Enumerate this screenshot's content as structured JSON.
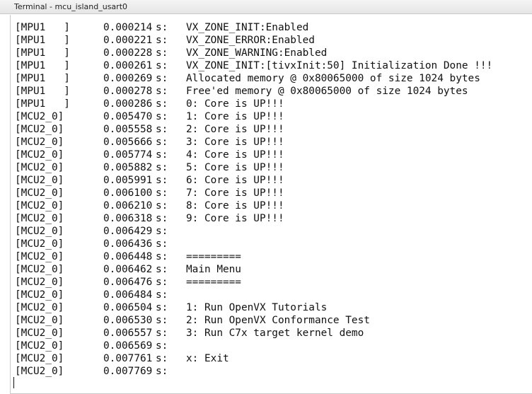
{
  "window": {
    "title": "Terminal - mcu_island_usart0"
  },
  "terminal": {
    "lines": [
      {
        "tag": "[MPU1   ]",
        "time": "0.000214",
        "unit": "s:",
        "message": "VX_ZONE_INIT:Enabled"
      },
      {
        "tag": "[MPU1   ]",
        "time": "0.000221",
        "unit": "s:",
        "message": "VX_ZONE_ERROR:Enabled"
      },
      {
        "tag": "[MPU1   ]",
        "time": "0.000228",
        "unit": "s:",
        "message": "VX_ZONE_WARNING:Enabled"
      },
      {
        "tag": "[MPU1   ]",
        "time": "0.000261",
        "unit": "s:",
        "message": "VX_ZONE_INIT:[tivxInit:50] Initialization Done !!!"
      },
      {
        "tag": "[MPU1   ]",
        "time": "0.000269",
        "unit": "s:",
        "message": "Allocated memory @ 0x80065000 of size 1024 bytes"
      },
      {
        "tag": "[MPU1   ]",
        "time": "0.000278",
        "unit": "s:",
        "message": "Free'ed memory @ 0x80065000 of size 1024 bytes"
      },
      {
        "tag": "[MPU1   ]",
        "time": "0.000286",
        "unit": "s:",
        "message": "0: Core is UP!!!"
      },
      {
        "tag": "[MCU2_0]",
        "time": "0.005470",
        "unit": "s:",
        "message": "1: Core is UP!!!"
      },
      {
        "tag": "[MCU2_0]",
        "time": "0.005558",
        "unit": "s:",
        "message": "2: Core is UP!!!"
      },
      {
        "tag": "[MCU2_0]",
        "time": "0.005666",
        "unit": "s:",
        "message": "3: Core is UP!!!"
      },
      {
        "tag": "[MCU2_0]",
        "time": "0.005774",
        "unit": "s:",
        "message": "4: Core is UP!!!"
      },
      {
        "tag": "[MCU2_0]",
        "time": "0.005882",
        "unit": "s:",
        "message": "5: Core is UP!!!"
      },
      {
        "tag": "[MCU2_0]",
        "time": "0.005991",
        "unit": "s:",
        "message": "6: Core is UP!!!"
      },
      {
        "tag": "[MCU2_0]",
        "time": "0.006100",
        "unit": "s:",
        "message": "7: Core is UP!!!"
      },
      {
        "tag": "[MCU2_0]",
        "time": "0.006210",
        "unit": "s:",
        "message": "8: Core is UP!!!"
      },
      {
        "tag": "[MCU2_0]",
        "time": "0.006318",
        "unit": "s:",
        "message": "9: Core is UP!!!"
      },
      {
        "tag": "[MCU2_0]",
        "time": "0.006429",
        "unit": "s:",
        "message": ""
      },
      {
        "tag": "[MCU2_0]",
        "time": "0.006436",
        "unit": "s:",
        "message": ""
      },
      {
        "tag": "[MCU2_0]",
        "time": "0.006448",
        "unit": "s:",
        "message": "========="
      },
      {
        "tag": "[MCU2_0]",
        "time": "0.006462",
        "unit": "s:",
        "message": "Main Menu"
      },
      {
        "tag": "[MCU2_0]",
        "time": "0.006476",
        "unit": "s:",
        "message": "========="
      },
      {
        "tag": "[MCU2_0]",
        "time": "0.006484",
        "unit": "s:",
        "message": ""
      },
      {
        "tag": "[MCU2_0]",
        "time": "0.006504",
        "unit": "s:",
        "message": "1: Run OpenVX Tutorials"
      },
      {
        "tag": "[MCU2_0]",
        "time": "0.006530",
        "unit": "s:",
        "message": "2: Run OpenVX Conformance Test"
      },
      {
        "tag": "[MCU2_0]",
        "time": "0.006557",
        "unit": "s:",
        "message": "3: Run C7x target kernel demo"
      },
      {
        "tag": "[MCU2_0]",
        "time": "0.006569",
        "unit": "s:",
        "message": ""
      },
      {
        "tag": "[MCU2_0]",
        "time": "0.007761",
        "unit": "s:",
        "message": "x: Exit"
      },
      {
        "tag": "[MCU2_0]",
        "time": "0.007769",
        "unit": "s:",
        "message": ""
      }
    ]
  }
}
